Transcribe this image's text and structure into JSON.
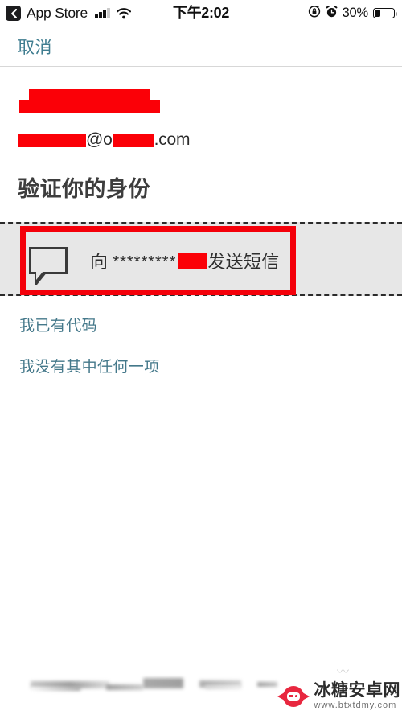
{
  "status_bar": {
    "back_icon": "chevron-left-icon",
    "app_name": "App Store",
    "signal_icon": "cellular-signal-icon",
    "wifi_icon": "wifi-icon",
    "time": "下午2:02",
    "rotation_lock_icon": "rotation-lock-icon",
    "alarm_icon": "alarm-clock-icon",
    "battery_percent": "30%",
    "battery_level": 30,
    "battery_icon": "battery-icon"
  },
  "navbar": {
    "cancel_label": "取消"
  },
  "account": {
    "name_redacted": true,
    "email_at": "@",
    "email_domain_start": "o",
    "email_tld": ".com",
    "email_redacted": true
  },
  "heading": {
    "title": "验证你的身份"
  },
  "verification_option": {
    "icon": "speech-bubble-icon",
    "prefix": "向",
    "masked_number": "*********",
    "number_redacted": true,
    "suffix": "发送短信",
    "highlight_color": "#f4000a",
    "row_background": "#e7e7e7"
  },
  "alt_links": [
    {
      "label": "我已有代码",
      "name": "already-have-code-link"
    },
    {
      "label": "我没有其中任何一项",
      "name": "none-of-these-link"
    }
  ],
  "watermark": {
    "logo_icon": "candy-gamepad-icon",
    "site_name": "冰糖安卓网",
    "site_url": "www.btxtdmy.com",
    "squiggle": "〰"
  },
  "colors": {
    "link_blue": "#44788a",
    "redaction_red": "#fb0007",
    "annotation_red": "#f4000a",
    "heading_gray": "#3d3d3d"
  }
}
